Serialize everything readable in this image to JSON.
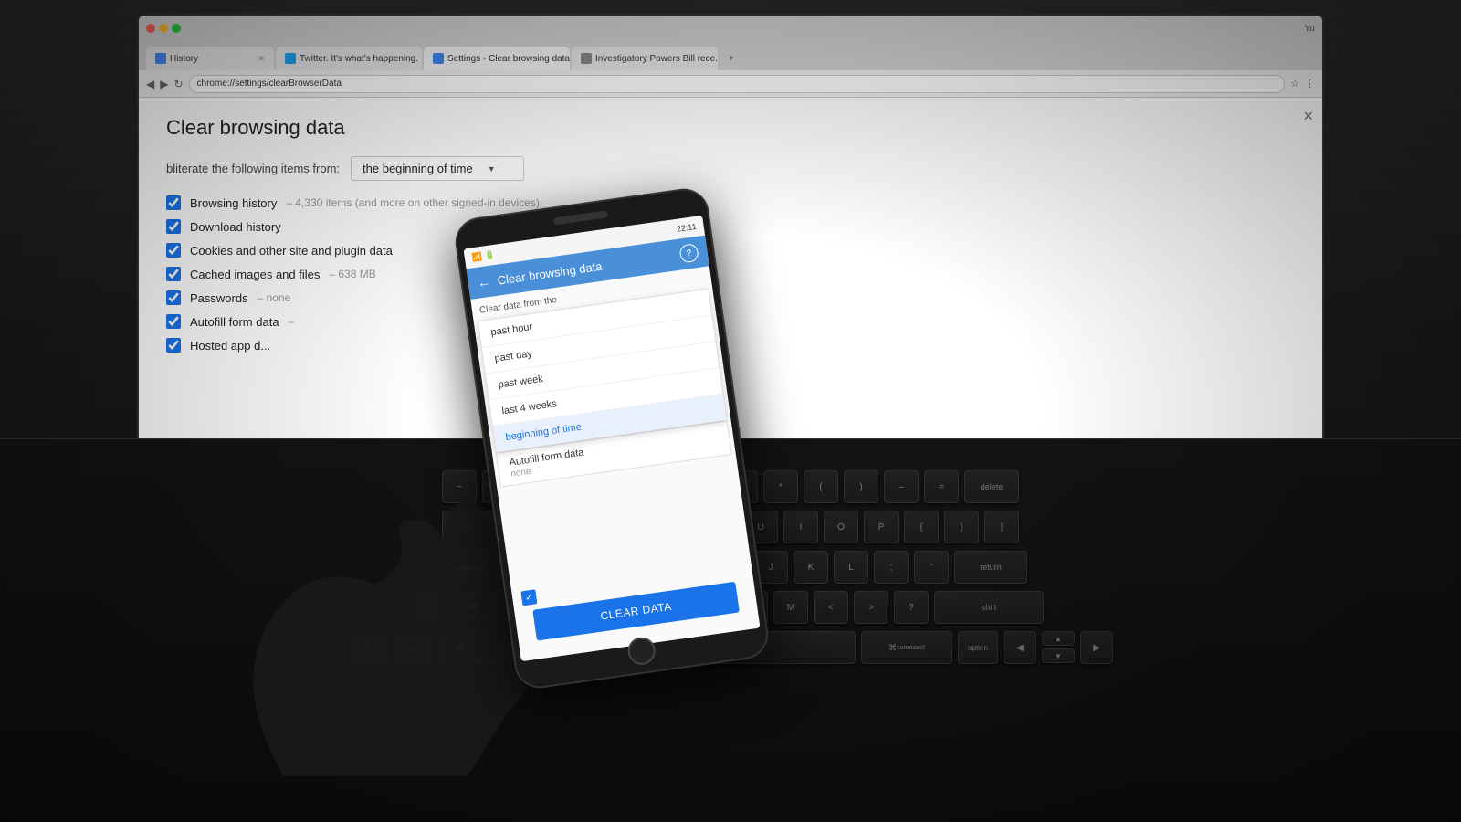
{
  "browser": {
    "tabs": [
      {
        "id": "history",
        "label": "History",
        "favicon_color": "#4285f4",
        "active": false
      },
      {
        "id": "twitter",
        "label": "Twitter. It's what's happening.",
        "favicon_color": "#1da1f2",
        "active": false
      },
      {
        "id": "settings",
        "label": "Settings - Clear browsing data",
        "favicon_color": "#4285f4",
        "active": true
      },
      {
        "id": "investigatory",
        "label": "Investigatory Powers Bill rece...",
        "favicon_color": "#888",
        "active": false
      }
    ],
    "url": "chrome://settings/clearBrowserData",
    "user_initial": "Yu"
  },
  "dialog": {
    "title": "Clear browsing data",
    "subtitle": "bliterate the following items from:",
    "time_range": "the beginning of time",
    "close_button": "×",
    "items": [
      {
        "id": "browsing_history",
        "label": "Browsing history",
        "detail": "– 4,330 items (and more on other signed-in devices)",
        "checked": true
      },
      {
        "id": "download_history",
        "label": "Download history",
        "detail": "",
        "checked": true
      },
      {
        "id": "cookies",
        "label": "Cookies and other site and plugin data",
        "detail": "",
        "checked": true
      },
      {
        "id": "cached_images",
        "label": "Cached images and files",
        "detail": "– 638 MB",
        "checked": true
      },
      {
        "id": "passwords",
        "label": "Passwords",
        "detail": "– none",
        "checked": true
      },
      {
        "id": "autofill",
        "label": "Autofill form data",
        "detail": "–",
        "checked": true
      },
      {
        "id": "hosted_app",
        "label": "Hosted app d...",
        "detail": "",
        "checked": true
      }
    ]
  },
  "phone": {
    "statusbar": {
      "time": "22:11",
      "icons": "signal wifi battery"
    },
    "topbar": {
      "title": "Clear browsing data",
      "back": "←"
    },
    "subtitle": "Clear data from the",
    "dropdown_items": [
      {
        "label": "past hour",
        "selected": false
      },
      {
        "label": "past day",
        "selected": false
      },
      {
        "label": "past week",
        "selected": false
      },
      {
        "label": "last 4 weeks",
        "selected": false
      },
      {
        "label": "beginning of time",
        "selected": true
      }
    ],
    "autofill_label": "Autofill form data",
    "autofill_detail": "none",
    "clear_button": "CLEAR DATA",
    "help_icon": "?"
  },
  "keyboard": {
    "visible": true
  }
}
